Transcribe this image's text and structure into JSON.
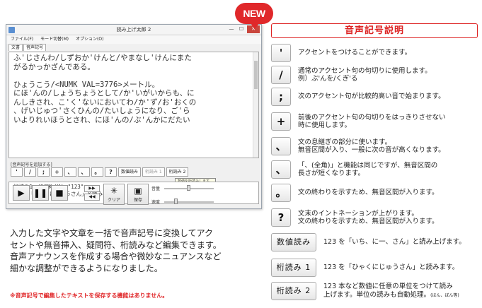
{
  "window": {
    "title": "読み上げ太郎 2",
    "controls": {
      "minimize": "—",
      "maximize": "☐",
      "close": "✕"
    },
    "menu": [
      "ファイル(F)",
      "モード切替(M)",
      "オプション(O)"
    ],
    "tabs": [
      "文書",
      "音声記号"
    ],
    "editor_lines": [
      "ふ'じさんわ/しずおか'けんと/やまなし'けんにまた",
      "がるかっかざんである。",
      "",
      "ひょうこう/<NUMK VAL=3776>メートル。",
      "にほ'んの/しょうちょうとして/か'いがいからも、に",
      "んしきされ、こ'く'ないにおいてわ/か'ず/お'おくの",
      "、げいじゅつ'さくひんの/たいしょうになり、ご'ら",
      "いよりれいほうとされ、にほ'んの/ぶ'んかにだたい"
    ],
    "symbol_group_label": "[音声記号を追加する]",
    "symbol_buttons": [
      "'",
      "/",
      ";",
      "+",
      "、",
      "、",
      "。",
      "?"
    ],
    "word_buttons": [
      "数値読み",
      "桁読み 1",
      "桁読み 2"
    ],
    "tooltip": "数値を桁読みします。",
    "output_lines": [
      "桁読み1  <NUMK VAL=\"123\">",
      "123を「ひゃくにじゅうさん」と読みます。"
    ],
    "playback": {
      "play": "▶",
      "pause": "❚❚",
      "stop": "■",
      "forward": "▶▶",
      "rewind": "◀◀"
    },
    "clear_label": "クリア",
    "save_label": "保存",
    "volume_label": "音量",
    "speed_label": "速度"
  },
  "badge": {
    "text": "NEW",
    "color": "#e0282a"
  },
  "description": [
    "入力した文字や文章を一括で音声記号に変換してアク",
    "セントや無音挿入、疑問符、桁読みなど編集できます。",
    "音声アナウンスを作成する場合や微妙なニュアンスなど",
    "細かな調整ができるようになりました。"
  ],
  "note": "※音声記号で編集したテキストを保存する機能はありません。",
  "panel": {
    "title": "音声記号説明",
    "accent_color": "#d22222",
    "items": [
      {
        "key": "'",
        "lines": [
          "アクセントをつけることができます。"
        ]
      },
      {
        "key": "/",
        "lines": [
          "通常のアクセント句の句切りに使用します。",
          "例）ぶ'んを/くぎ'る"
        ]
      },
      {
        "key": ";",
        "lines": [
          "次のアクセント句が比較的高い音で始まります。"
        ]
      },
      {
        "key": "+",
        "lines": [
          "前後のアクセント句の句切りをはっきりさせない",
          "時に使用します。"
        ]
      },
      {
        "key": "、",
        "lines": [
          "文の息継ぎの部分に使います。",
          "無音区間が入り、一般に次の音が高くなります。"
        ]
      },
      {
        "key": "、",
        "lines": [
          "「、(全角)」と機能は同じですが、無音区間の",
          "長さが短くなります。"
        ]
      },
      {
        "key": "。",
        "lines": [
          "文の終わりを示すため、無音区間が入ります。"
        ]
      },
      {
        "key": "?",
        "lines": [
          "文末のイントネーションが上がります。",
          "文の終わりを示すため、無音区間が入ります。"
        ]
      },
      {
        "key": "数値読み",
        "lines": [
          "123 を「いち、に一、さん」と読み上げます。"
        ]
      },
      {
        "key": "桁読み 1",
        "lines": [
          "123 を「ひゃくにじゅうさん」と読みます。"
        ]
      },
      {
        "key": "桁読み 2",
        "lines": [
          "123 本など数値に任意の単位をつけて読み",
          "上げます。単位の読みも自動処理。"
        ],
        "suffix": "(ほん、ぼん等)"
      }
    ]
  }
}
